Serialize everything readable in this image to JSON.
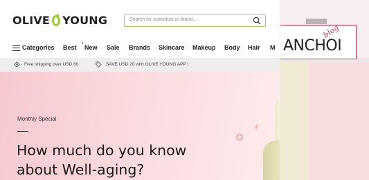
{
  "brand": {
    "logo_left": "OLIVE",
    "logo_right": "YOUNG",
    "accent": "#9bce2e"
  },
  "search": {
    "placeholder": "Search for a product or brand...",
    "icon": "search-icon"
  },
  "nav": {
    "categories_label": "Categories",
    "items": [
      "Best",
      "New",
      "Sale",
      "Brands",
      "Skincare",
      "Makeup",
      "Body",
      "Hair",
      "M"
    ]
  },
  "promo": {
    "shipping": "Free shipping over USD 60",
    "app": "SAVE USD 20 with OLIVE YOUNG APP !"
  },
  "hero": {
    "kicker": "Monthly Special",
    "title_line1": "How much do you know",
    "title_line2": "about Well-aging?"
  },
  "watermark": {
    "blog": "blog",
    "name": "ANCHOI",
    "color": "#d23a55"
  }
}
